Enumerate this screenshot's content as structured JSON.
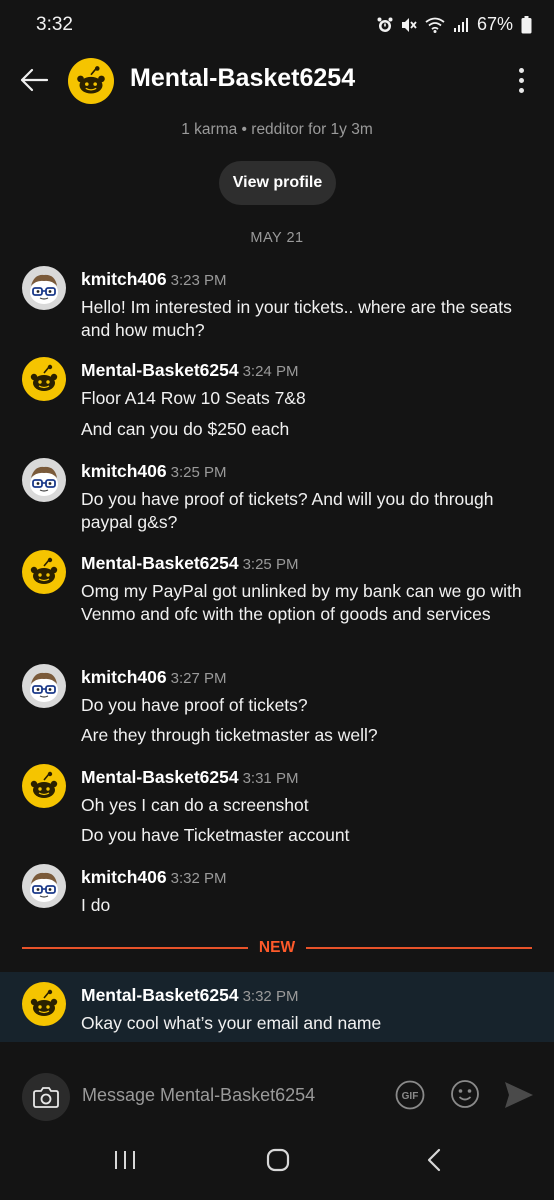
{
  "status": {
    "time": "3:32",
    "battery": "67%"
  },
  "header": {
    "title": "Mental-Basket6254",
    "karma": "1 karma • redditor for 1y 3m",
    "view_profile": "View profile"
  },
  "date_separator": "MAY 21",
  "messages": [
    {
      "user": "kmitch406",
      "time": "3:23 PM",
      "lines": [
        "Hello! Im interested in your tickets.. where are the seats and how much?"
      ]
    },
    {
      "user": "Mental-Basket6254",
      "time": "3:24 PM",
      "lines": [
        "Floor A14 Row 10 Seats 7&8",
        "And can you do $250 each"
      ]
    },
    {
      "user": "kmitch406",
      "time": "3:25 PM",
      "lines": [
        "Do you have proof of tickets? And will you do through paypal g&s?"
      ]
    },
    {
      "user": "Mental-Basket6254",
      "time": "3:25 PM",
      "lines": [
        "Omg my PayPal got unlinked by my bank can we go with Venmo and ofc with the option of goods and services"
      ]
    },
    {
      "user": "kmitch406",
      "time": "3:27 PM",
      "lines": [
        "Do you have proof of tickets?",
        "Are they through ticketmaster as well?"
      ]
    },
    {
      "user": "Mental-Basket6254",
      "time": "3:31 PM",
      "lines": [
        "Oh yes I can do a screenshot",
        "Do you have Ticketmaster account"
      ]
    },
    {
      "user": "kmitch406",
      "time": "3:32 PM",
      "lines": [
        "I do"
      ]
    },
    {
      "user": "Mental-Basket6254",
      "time": "3:32 PM",
      "lines": [
        "Okay cool what’s your email and name"
      ]
    }
  ],
  "new_divider": "NEW",
  "composer": {
    "placeholder": "Message Mental-Basket6254",
    "gif_label": "GIF"
  },
  "colors": {
    "background": "#141414",
    "accent_new": "#ff5a2a",
    "snoo_yellow": "#f5c400",
    "highlight_row": "#17232c"
  },
  "icons": [
    "back-arrow-icon",
    "more-vertical-icon",
    "camera-icon",
    "gif-icon",
    "emoji-icon",
    "send-icon",
    "alarm-icon",
    "mute-icon",
    "wifi-icon",
    "signal-icon",
    "battery-icon"
  ]
}
